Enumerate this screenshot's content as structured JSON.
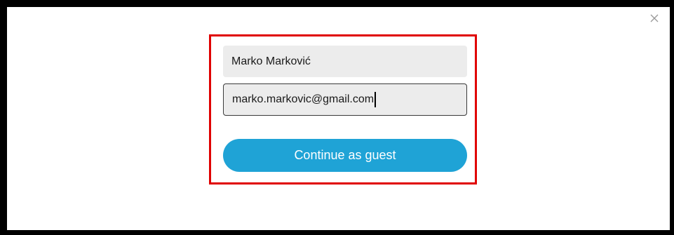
{
  "dialog": {
    "close_icon": "close-icon",
    "name_value": "Marko Marković",
    "email_value": "marko.markovic@gmail.com",
    "continue_label": "Continue as guest"
  },
  "colors": {
    "frame": "#000000",
    "dialog_background": "#ffffff",
    "highlight_border": "#e00000",
    "field_background": "#ececec",
    "button_background": "#1fa3d6",
    "button_text": "#ffffff",
    "close_icon": "#9a9a9a"
  }
}
